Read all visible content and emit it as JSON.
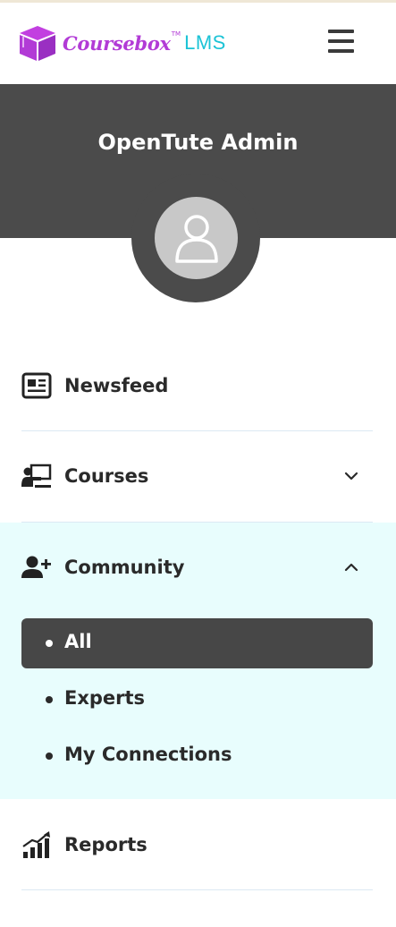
{
  "brand": {
    "name": "Coursebox",
    "trademark": "TM",
    "suffix": "LMS",
    "colors": {
      "primary": "#b23bd6",
      "secondary": "#1cc3d6"
    }
  },
  "header": {
    "menu_icon": "hamburger-icon"
  },
  "profile": {
    "name": "OpenTute Admin",
    "avatar_icon": "user-icon",
    "banner_color": "#4b4b4b"
  },
  "nav": {
    "newsfeed": {
      "label": "Newsfeed",
      "icon": "newspaper-icon"
    },
    "courses": {
      "label": "Courses",
      "icon": "teacher-board-icon",
      "expanded": false
    },
    "community": {
      "label": "Community",
      "icon": "user-plus-icon",
      "expanded": true,
      "highlight_color": "#e8fdfd",
      "items": [
        {
          "label": "All",
          "active": true
        },
        {
          "label": "Experts",
          "active": false
        },
        {
          "label": "My Connections",
          "active": false
        }
      ]
    },
    "reports": {
      "label": "Reports",
      "icon": "chart-growth-icon"
    }
  }
}
